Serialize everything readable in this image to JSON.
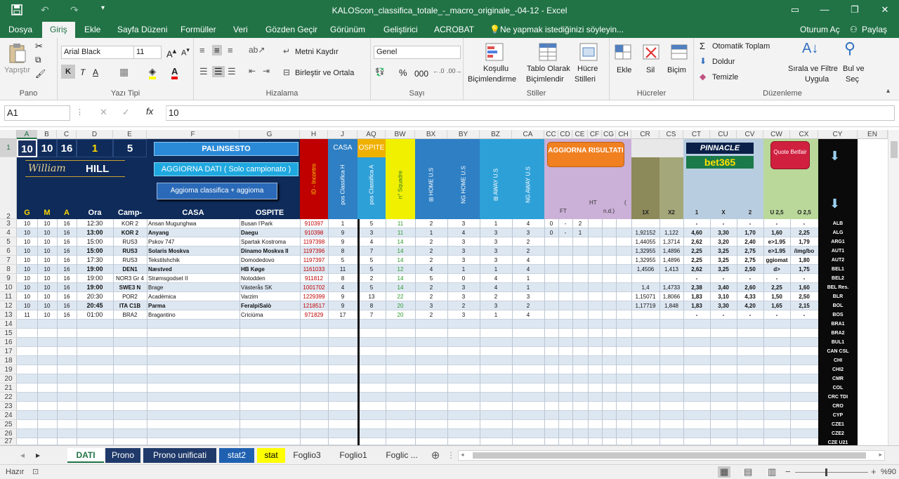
{
  "window": {
    "title": "KALOScon_classifica_totale_-_macro_originale_-04-12 - Excel"
  },
  "tabs": [
    "Dosya",
    "Giriş",
    "Ekle",
    "Sayfa Düzeni",
    "Formüller",
    "Veri",
    "Gözden Geçir",
    "Görünüm",
    "Geliştirici",
    "ACROBAT"
  ],
  "active_tab": "Giriş",
  "tell_me": "Ne yapmak istediğinizi söyleyin...",
  "sign_in": "Oturum Aç",
  "share": "Paylaş",
  "ribbon": {
    "paste": "Yapıştır",
    "clipboard": "Pano",
    "font_name": "Arial Black",
    "font_size": "11",
    "font_group": "Yazı Tipi",
    "bold": "K",
    "italic": "T",
    "underline": "A",
    "wrap": "Metni Kaydır",
    "merge": "Birleştir ve Ortala",
    "align_group": "Hizalama",
    "number_format": "Genel",
    "number_group": "Sayı",
    "cond1": "Koşullu",
    "cond2": "Biçimlendirme",
    "table1": "Tablo Olarak",
    "table2": "Biçimlendir",
    "cell1": "Hücre",
    "cell2": "Stilleri",
    "styles_group": "Stiller",
    "insert": "Ekle",
    "delete": "Sil",
    "format": "Biçim",
    "cells_group": "Hücreler",
    "autosum": "Otomatik Toplam",
    "fill": "Doldur",
    "clear": "Temizle",
    "sort1": "Sırala ve Filtre",
    "sort2": "Uygula",
    "find1": "Bul ve",
    "find2": "Seç",
    "editing_group": "Düzenleme"
  },
  "formula": {
    "namebox": "A1",
    "fx": "fx",
    "value": "10"
  },
  "columns": [
    "A",
    "B",
    "C",
    "D",
    "E",
    "F",
    "G",
    "H",
    "J",
    "AQ",
    "BW",
    "BX",
    "BY",
    "BZ",
    "CA",
    "CC",
    "CD",
    "CE",
    "CF",
    "CG",
    "CH",
    "CR",
    "CS",
    "CT",
    "CU",
    "CV",
    "CW",
    "CX",
    "CY",
    "EN"
  ],
  "rows": [
    "1",
    "2",
    "3",
    "4",
    "5",
    "6",
    "7",
    "8",
    "9",
    "10",
    "11",
    "12",
    "13",
    "14",
    "15",
    "16",
    "17",
    "18",
    "19",
    "20",
    "21",
    "22",
    "23",
    "24",
    "25",
    "26",
    "27"
  ],
  "header": {
    "date_vals": [
      "10",
      "10",
      "16",
      "1",
      "5"
    ],
    "logo_william": "William",
    "logo_hill": "HILL",
    "btn_palinsesto": "PALINSESTO",
    "btn_aggiorna": "AGGIORNA DATI  ( Solo campionato )",
    "btn_classifica": "Aggioma classifica + aggioma",
    "id_incontro": "ID - Incontro",
    "casa": "CASA",
    "ospite": "OSPITE",
    "pos_casa": "pos Classifica H",
    "pos_ospite": "pos Classifica A",
    "squadre": "n° Squadre",
    "home_us": "⊞ HOME U.S",
    "ng_home": "NG HOME U.S",
    "away_us": "⊞ AWAY U.S",
    "ng_away": "NG AWAY U.S",
    "aggiorna_risultati": "AGGIORNA RISULTATI",
    "ft": "FT",
    "ht": "HT",
    "ht_bracket": "(",
    "nd": "n.d.)",
    "pinnacle": "PINNACLE",
    "bet365": "bet365",
    "quote_betfair": "Quote Betfair",
    "arrow_down": "⬇",
    "lbl_g": "G",
    "lbl_m": "M",
    "lbl_a": "A",
    "lbl_ora": "Ora",
    "lbl_camp": "Camp-",
    "lbl_casa": "CASA",
    "lbl_ospite": "OSPITE",
    "lbl_1x": "1X",
    "lbl_x2": "X2",
    "lbl_1": "1",
    "lbl_x": "X",
    "lbl_2": "2",
    "lbl_u25": "U 2,5",
    "lbl_o25": "O 2,5"
  },
  "matches": [
    {
      "g": "10",
      "m": "10",
      "a": "16",
      "ora": "12:30",
      "camp": "KOR 2",
      "casa": "Ansan Mugunghwa",
      "ospite": "Busan I'Park",
      "id": "910397",
      "j": "1",
      "aq": "5",
      "bw": "11",
      "bx": "2",
      "by": "3",
      "bz": "1",
      "ca": "4",
      "cc": "0",
      "cd": "-",
      "ce": "2",
      "cr": "",
      "cs": "",
      "ct": "-",
      "cu": "-",
      "cv": "-",
      "cw": "-",
      "cx": "-"
    },
    {
      "g": "10",
      "m": "10",
      "a": "16",
      "ora": "13:00",
      "camp": "KOR 2",
      "casa": "Anyang",
      "ospite": "Daegu",
      "id": "910398",
      "j": "9",
      "aq": "3",
      "bw": "11",
      "bx": "1",
      "by": "4",
      "bz": "3",
      "ca": "3",
      "cc": "0",
      "cd": "-",
      "ce": "1",
      "cr": "1,92152",
      "cs": "1,122",
      "ct": "4,60",
      "cu": "3,30",
      "cv": "1,70",
      "cw": "1,60",
      "cx": "2,25"
    },
    {
      "g": "10",
      "m": "10",
      "a": "16",
      "ora": "15:00",
      "camp": "RUS3",
      "casa": "Pskov 747",
      "ospite": "Spartak Kostroma",
      "id": "1197398",
      "j": "9",
      "aq": "4",
      "bw": "14",
      "bx": "2",
      "by": "3",
      "bz": "3",
      "ca": "2",
      "cc": "",
      "cd": "",
      "ce": "",
      "cr": "1,44055",
      "cs": "1,3714",
      "ct": "2,62",
      "cu": "3,20",
      "cv": "2,40",
      "cw": "e>1.95",
      "cx": "1,79"
    },
    {
      "g": "10",
      "m": "10",
      "a": "16",
      "ora": "15:00",
      "camp": "RUS3",
      "casa": "Solaris Moskva",
      "ospite": "Dinamo Moskva II",
      "id": "1197396",
      "j": "8",
      "aq": "7",
      "bw": "14",
      "bx": "2",
      "by": "3",
      "bz": "3",
      "ca": "2",
      "cc": "",
      "cd": "",
      "ce": "",
      "cr": "1,32955",
      "cs": "1,4896",
      "ct": "2,25",
      "cu": "3,25",
      "cv": "2,75",
      "cw": "e>1.95",
      "cx": "/img/bo"
    },
    {
      "g": "10",
      "m": "10",
      "a": "16",
      "ora": "17:30",
      "camp": "RUS3",
      "casa": "Tekstilshchik",
      "ospite": "Domodedovo",
      "id": "1197397",
      "j": "5",
      "aq": "5",
      "bw": "14",
      "bx": "2",
      "by": "3",
      "bz": "3",
      "ca": "4",
      "cc": "",
      "cd": "",
      "ce": "",
      "cr": "1,32955",
      "cs": "1,4896",
      "ct": "2,25",
      "cu": "3,25",
      "cv": "2,75",
      "cw": "ggiomat",
      "cx": "1,80"
    },
    {
      "g": "10",
      "m": "10",
      "a": "16",
      "ora": "19:00",
      "camp": "DEN1",
      "casa": "Næstved",
      "ospite": "HB Køge",
      "id": "1161033",
      "j": "11",
      "aq": "5",
      "bw": "12",
      "bx": "4",
      "by": "1",
      "bz": "1",
      "ca": "4",
      "cc": "",
      "cd": "",
      "ce": "",
      "cr": "1,4506",
      "cs": "1,413",
      "ct": "2,62",
      "cu": "3,25",
      "cv": "2,50",
      "cw": "d>",
      "cx": "1,75"
    },
    {
      "g": "10",
      "m": "10",
      "a": "16",
      "ora": "19:00",
      "camp": "NOR3 Gr 4",
      "casa": "Strømsgodset II",
      "ospite": "Notodden",
      "id": "911812",
      "j": "8",
      "aq": "2",
      "bw": "14",
      "bx": "5",
      "by": "0",
      "bz": "4",
      "ca": "1",
      "cc": "",
      "cd": "",
      "ce": "",
      "cr": "",
      "cs": "",
      "ct": "-",
      "cu": "-",
      "cv": "-",
      "cw": "-",
      "cx": "-"
    },
    {
      "g": "10",
      "m": "10",
      "a": "16",
      "ora": "19:00",
      "camp": "SWE3 N",
      "casa": "Brage",
      "ospite": "Västerås SK",
      "id": "1001702",
      "j": "4",
      "aq": "5",
      "bw": "14",
      "bx": "2",
      "by": "3",
      "bz": "4",
      "ca": "1",
      "cc": "",
      "cd": "",
      "ce": "",
      "cr": "1,4",
      "cs": "1,4733",
      "ct": "2,38",
      "cu": "3,40",
      "cv": "2,60",
      "cw": "2,25",
      "cx": "1,60"
    },
    {
      "g": "10",
      "m": "10",
      "a": "16",
      "ora": "20:30",
      "camp": "POR2",
      "casa": "Académica",
      "ospite": "Varzim",
      "id": "1229399",
      "j": "9",
      "aq": "13",
      "bw": "22",
      "bx": "2",
      "by": "3",
      "bz": "2",
      "ca": "3",
      "cc": "",
      "cd": "",
      "ce": "",
      "cr": "1,15071",
      "cs": "1,8066",
      "ct": "1,83",
      "cu": "3,10",
      "cv": "4,33",
      "cw": "1,50",
      "cx": "2,50"
    },
    {
      "g": "10",
      "m": "10",
      "a": "16",
      "ora": "20:45",
      "camp": "ITA C1B",
      "casa": "Parma",
      "ospite": "FeralpiSalò",
      "id": "1218517",
      "j": "9",
      "aq": "8",
      "bw": "20",
      "bx": "3",
      "by": "2",
      "bz": "3",
      "ca": "2",
      "cc": "",
      "cd": "",
      "ce": "",
      "cr": "1,17719",
      "cs": "1,848",
      "ct": "1,83",
      "cu": "3,30",
      "cv": "4,20",
      "cw": "1,65",
      "cx": "2,15"
    },
    {
      "g": "11",
      "m": "10",
      "a": "16",
      "ora": "01:00",
      "camp": "BRA2",
      "casa": "Bragantino",
      "ospite": "Criciúma",
      "id": "971829",
      "j": "17",
      "aq": "7",
      "bw": "20",
      "bx": "2",
      "by": "3",
      "bz": "1",
      "ca": "4",
      "cc": "",
      "cd": "",
      "ce": "",
      "cr": "",
      "cs": "",
      "ct": "-",
      "cu": "-",
      "cv": "-",
      "cw": "-",
      "cx": "-"
    }
  ],
  "leagues": [
    "ALB",
    "ALG",
    "ARG1",
    "AUT1",
    "AUT2",
    "BEL1",
    "BEL2",
    "BEL Res.",
    "BLR",
    "BOL",
    "BOS",
    "BRA1",
    "BRA2",
    "BUL1",
    "CAN CSL",
    "CHI",
    "CHI2",
    "CMR",
    "COL",
    "CRC TDI",
    "CRO",
    "CYP",
    "CZE1",
    "CZE2",
    "CZE U21"
  ],
  "sheets": [
    "DATI",
    "Prono",
    "Prono unificati",
    "stat2",
    "stat",
    "Foglio3",
    "Foglio1",
    "Foglic ..."
  ],
  "active_sheet": "DATI",
  "status": {
    "ready": "Hazır",
    "zoom": "%90"
  }
}
